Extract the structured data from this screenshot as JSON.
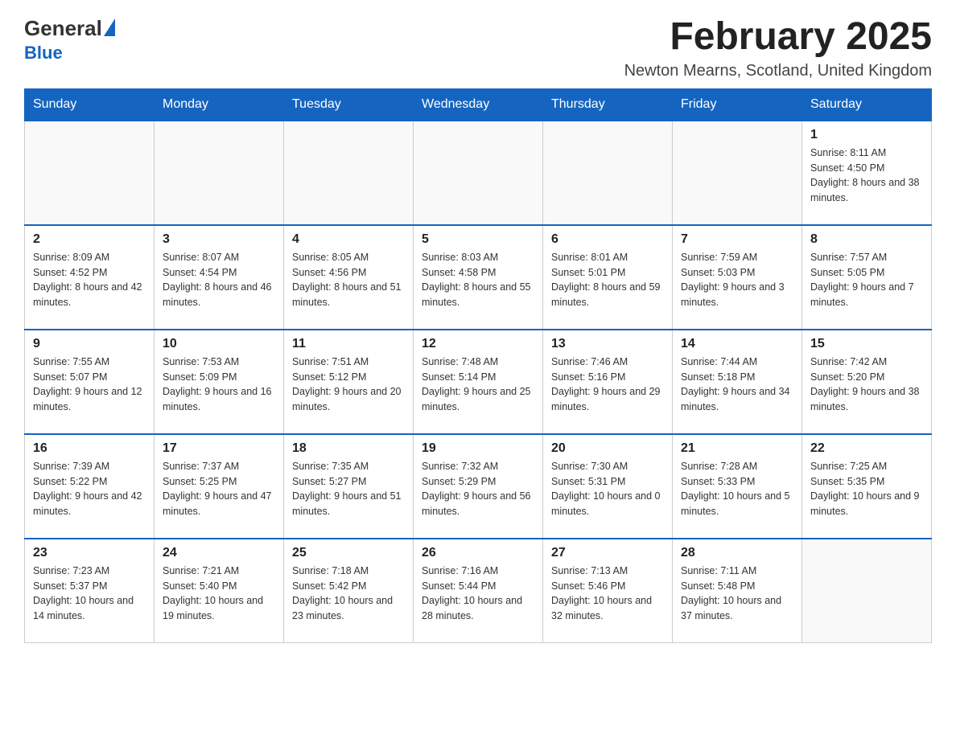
{
  "header": {
    "logo_general": "General",
    "logo_blue": "Blue",
    "month_title": "February 2025",
    "location": "Newton Mearns, Scotland, United Kingdom"
  },
  "days_of_week": [
    "Sunday",
    "Monday",
    "Tuesday",
    "Wednesday",
    "Thursday",
    "Friday",
    "Saturday"
  ],
  "weeks": [
    {
      "days": [
        {
          "number": "",
          "info": ""
        },
        {
          "number": "",
          "info": ""
        },
        {
          "number": "",
          "info": ""
        },
        {
          "number": "",
          "info": ""
        },
        {
          "number": "",
          "info": ""
        },
        {
          "number": "",
          "info": ""
        },
        {
          "number": "1",
          "info": "Sunrise: 8:11 AM\nSunset: 4:50 PM\nDaylight: 8 hours and 38 minutes."
        }
      ]
    },
    {
      "days": [
        {
          "number": "2",
          "info": "Sunrise: 8:09 AM\nSunset: 4:52 PM\nDaylight: 8 hours and 42 minutes."
        },
        {
          "number": "3",
          "info": "Sunrise: 8:07 AM\nSunset: 4:54 PM\nDaylight: 8 hours and 46 minutes."
        },
        {
          "number": "4",
          "info": "Sunrise: 8:05 AM\nSunset: 4:56 PM\nDaylight: 8 hours and 51 minutes."
        },
        {
          "number": "5",
          "info": "Sunrise: 8:03 AM\nSunset: 4:58 PM\nDaylight: 8 hours and 55 minutes."
        },
        {
          "number": "6",
          "info": "Sunrise: 8:01 AM\nSunset: 5:01 PM\nDaylight: 8 hours and 59 minutes."
        },
        {
          "number": "7",
          "info": "Sunrise: 7:59 AM\nSunset: 5:03 PM\nDaylight: 9 hours and 3 minutes."
        },
        {
          "number": "8",
          "info": "Sunrise: 7:57 AM\nSunset: 5:05 PM\nDaylight: 9 hours and 7 minutes."
        }
      ]
    },
    {
      "days": [
        {
          "number": "9",
          "info": "Sunrise: 7:55 AM\nSunset: 5:07 PM\nDaylight: 9 hours and 12 minutes."
        },
        {
          "number": "10",
          "info": "Sunrise: 7:53 AM\nSunset: 5:09 PM\nDaylight: 9 hours and 16 minutes."
        },
        {
          "number": "11",
          "info": "Sunrise: 7:51 AM\nSunset: 5:12 PM\nDaylight: 9 hours and 20 minutes."
        },
        {
          "number": "12",
          "info": "Sunrise: 7:48 AM\nSunset: 5:14 PM\nDaylight: 9 hours and 25 minutes."
        },
        {
          "number": "13",
          "info": "Sunrise: 7:46 AM\nSunset: 5:16 PM\nDaylight: 9 hours and 29 minutes."
        },
        {
          "number": "14",
          "info": "Sunrise: 7:44 AM\nSunset: 5:18 PM\nDaylight: 9 hours and 34 minutes."
        },
        {
          "number": "15",
          "info": "Sunrise: 7:42 AM\nSunset: 5:20 PM\nDaylight: 9 hours and 38 minutes."
        }
      ]
    },
    {
      "days": [
        {
          "number": "16",
          "info": "Sunrise: 7:39 AM\nSunset: 5:22 PM\nDaylight: 9 hours and 42 minutes."
        },
        {
          "number": "17",
          "info": "Sunrise: 7:37 AM\nSunset: 5:25 PM\nDaylight: 9 hours and 47 minutes."
        },
        {
          "number": "18",
          "info": "Sunrise: 7:35 AM\nSunset: 5:27 PM\nDaylight: 9 hours and 51 minutes."
        },
        {
          "number": "19",
          "info": "Sunrise: 7:32 AM\nSunset: 5:29 PM\nDaylight: 9 hours and 56 minutes."
        },
        {
          "number": "20",
          "info": "Sunrise: 7:30 AM\nSunset: 5:31 PM\nDaylight: 10 hours and 0 minutes."
        },
        {
          "number": "21",
          "info": "Sunrise: 7:28 AM\nSunset: 5:33 PM\nDaylight: 10 hours and 5 minutes."
        },
        {
          "number": "22",
          "info": "Sunrise: 7:25 AM\nSunset: 5:35 PM\nDaylight: 10 hours and 9 minutes."
        }
      ]
    },
    {
      "days": [
        {
          "number": "23",
          "info": "Sunrise: 7:23 AM\nSunset: 5:37 PM\nDaylight: 10 hours and 14 minutes."
        },
        {
          "number": "24",
          "info": "Sunrise: 7:21 AM\nSunset: 5:40 PM\nDaylight: 10 hours and 19 minutes."
        },
        {
          "number": "25",
          "info": "Sunrise: 7:18 AM\nSunset: 5:42 PM\nDaylight: 10 hours and 23 minutes."
        },
        {
          "number": "26",
          "info": "Sunrise: 7:16 AM\nSunset: 5:44 PM\nDaylight: 10 hours and 28 minutes."
        },
        {
          "number": "27",
          "info": "Sunrise: 7:13 AM\nSunset: 5:46 PM\nDaylight: 10 hours and 32 minutes."
        },
        {
          "number": "28",
          "info": "Sunrise: 7:11 AM\nSunset: 5:48 PM\nDaylight: 10 hours and 37 minutes."
        },
        {
          "number": "",
          "info": ""
        }
      ]
    }
  ]
}
